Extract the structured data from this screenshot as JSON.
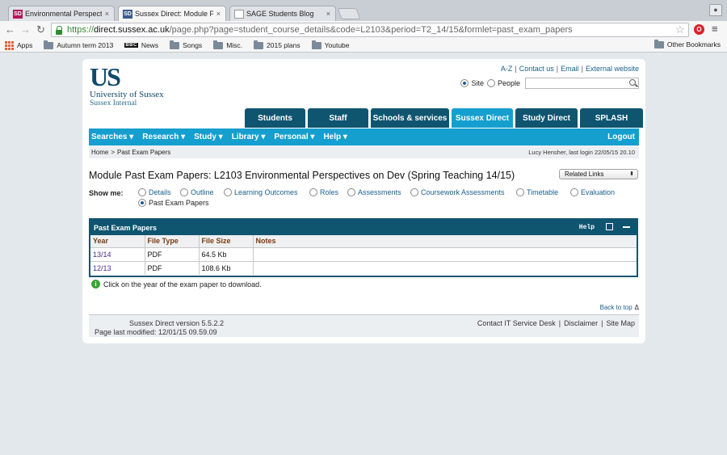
{
  "browser": {
    "tabs": [
      {
        "title": "Environmental Perspective",
        "favicon": "SD",
        "favicon_color": "#b5165a",
        "active": false
      },
      {
        "title": "Sussex Direct: Module Pas",
        "favicon": "SD",
        "favicon_color": "#3a5a8c",
        "active": true
      },
      {
        "title": "SAGE Students Blog",
        "favicon": "",
        "favicon_color": "#ffffff",
        "active": false
      }
    ],
    "close_glyph": "×",
    "url": {
      "scheme": "https://",
      "host": "direct.sussex.ac.uk",
      "rest": "/page.php?page=student_course_details&code=L2103&period=T2_14/15&formlet=past_exam_papers"
    },
    "bookmarks": [
      {
        "label": "Apps",
        "icon": "apps-icon"
      },
      {
        "label": "Autumn term 2013",
        "icon": "folder-icon"
      },
      {
        "label": "News",
        "icon": "bbc-icon"
      },
      {
        "label": "Songs",
        "icon": "folder-icon"
      },
      {
        "label": "Misc.",
        "icon": "folder-icon"
      },
      {
        "label": "2015 plans",
        "icon": "folder-icon"
      },
      {
        "label": "Youtube",
        "icon": "folder-icon"
      }
    ],
    "bbc_text": "BBC",
    "other_bookmarks": "Other Bookmarks"
  },
  "site": {
    "logo": {
      "mark": "US",
      "name": "University of Sussex",
      "sub": "Sussex Internal"
    },
    "toplinks": [
      "A-Z",
      "Contact us",
      "Email",
      "External website"
    ],
    "toplinks_sep": "|",
    "search": {
      "site_label": "Site",
      "people_label": "People",
      "value": ""
    },
    "main_tabs": [
      {
        "label": "Students",
        "active": false
      },
      {
        "label": "Staff",
        "active": false
      },
      {
        "label": "Schools & services",
        "active": false
      },
      {
        "label": "Sussex Direct",
        "active": true
      },
      {
        "label": "Study Direct",
        "active": false
      },
      {
        "label": "SPLASH",
        "active": false
      }
    ],
    "nav": [
      "Searches ▾",
      "Research ▾",
      "Study ▾",
      "Library ▾",
      "Personal ▾",
      "Help ▾"
    ],
    "logout": "Logout",
    "breadcrumb": {
      "home": "Home",
      "sep": ">",
      "current": "Past Exam Papers"
    },
    "last_login": "Lucy Hensher, last login 22/05/15 20.10"
  },
  "content": {
    "title": "Module Past Exam Papers: L2103 Environmental Perspectives on Dev (Spring Teaching 14/15)",
    "related_links": "Related Links",
    "related_arrows": "⬍",
    "show_me_label": "Show me:",
    "show_me_options": [
      {
        "label": "Details",
        "selected": false
      },
      {
        "label": "Outline",
        "selected": false
      },
      {
        "label": "Learning Outcomes",
        "selected": false
      },
      {
        "label": "Roles",
        "selected": false
      },
      {
        "label": "Assessments",
        "selected": false
      },
      {
        "label": "Coursework Assessments",
        "selected": false
      },
      {
        "label": "Timetable",
        "selected": false
      },
      {
        "label": "Evaluation",
        "selected": false
      },
      {
        "label": "Past Exam Papers",
        "selected": true
      }
    ],
    "panel": {
      "title": "Past Exam Papers",
      "help": "Help",
      "columns": [
        "Year",
        "File Type",
        "File Size",
        "Notes"
      ],
      "rows": [
        {
          "year": "13/14",
          "type": "PDF",
          "size": "64.5 Kb",
          "notes": ""
        },
        {
          "year": "12/13",
          "type": "PDF",
          "size": "108.6 Kb",
          "notes": ""
        }
      ]
    },
    "info": "Click on the year of the exam paper to download.",
    "info_glyph": "i",
    "back_to_top": "Back to top",
    "back_to_top_glyph": "Δ"
  },
  "footer": {
    "version": "Sussex Direct version 5.5.2.2",
    "modified": "Page last modified: 12/01/15 09.59.09",
    "links": [
      "Contact IT Service Desk",
      "Disclaimer",
      "Site Map"
    ]
  }
}
